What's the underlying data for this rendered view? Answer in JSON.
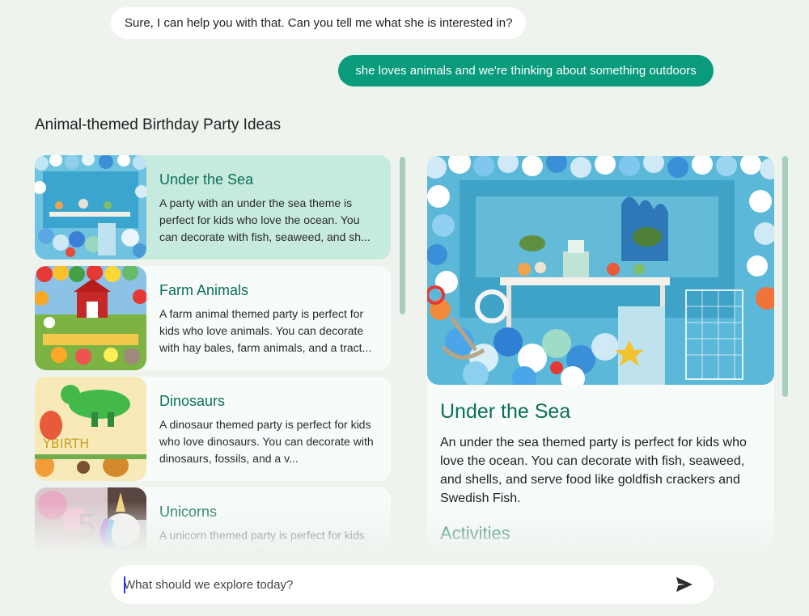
{
  "chat": {
    "bot_message": "Sure, I can help you with that. Can you tell me what she is interested in?",
    "user_message": "she loves animals and we're thinking about something outdoors"
  },
  "section_title": "Animal-themed Birthday Party Ideas",
  "ideas": [
    {
      "title": "Under the Sea",
      "description": "A party with an under the sea theme is perfect for kids who love the ocean. You can decorate with fish, seaweed, and sh...",
      "image": "under-the-sea-party-photo",
      "selected": true
    },
    {
      "title": "Farm Animals",
      "description": "A farm animal themed party is perfect for kids who love animals. You can decorate with hay bales, farm animals, and a tract...",
      "image": "farm-party-photo",
      "selected": false
    },
    {
      "title": "Dinosaurs",
      "description": "A dinosaur themed party is perfect for kids who love dinosaurs. You can decorate with dinosaurs, fossils, and a v...",
      "image": "dinosaur-party-photo",
      "selected": false
    },
    {
      "title": "Unicorns",
      "description": "A unicorn themed party is perfect for kids who love unicorns. You can decorate with",
      "image": "unicorn-party-photo",
      "selected": false
    }
  ],
  "detail": {
    "title": "Under the Sea",
    "description": "An under the sea themed party is perfect for kids who love the ocean. You can decorate with fish, seaweed, and shells, and serve food like goldfish crackers and Swedish Fish.",
    "subheading": "Activities",
    "image": "under-the-sea-party-photo"
  },
  "input": {
    "placeholder": "What should we explore today?",
    "send_icon": "send-icon"
  },
  "colors": {
    "background": "#eef3ee",
    "accent": "#0a9a7c",
    "title_green": "#0d6e57",
    "selected_card": "#c6eadd"
  }
}
